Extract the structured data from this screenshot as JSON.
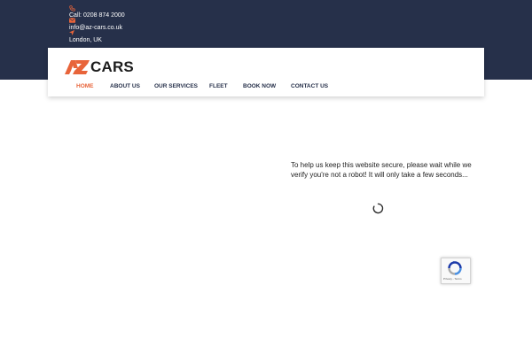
{
  "contact": {
    "phone": "Call: 0208 874 2000",
    "email": "info@az-cars.co.uk",
    "location": "London, UK",
    "phone_icon": "phone-icon",
    "email_icon": "envelope-icon",
    "location_icon": "location-arrow-icon"
  },
  "logo": {
    "text": "CARS",
    "mark": "AZ"
  },
  "nav": {
    "items": [
      {
        "label": "HOME",
        "active": true
      },
      {
        "label": "ABOUT US",
        "active": false
      },
      {
        "label": "OUR SERVICES",
        "active": false
      },
      {
        "label": "FLEET",
        "active": false
      },
      {
        "label": "BOOK NOW",
        "active": false
      },
      {
        "label": "CONTACT US",
        "active": false
      }
    ]
  },
  "security": {
    "message": "To help us keep this website secure, please wait while we verify you're not a robot! It will only take a few seconds..."
  },
  "recaptcha": {
    "footer": "Privacy - Terms"
  },
  "colors": {
    "header_bg": "#26304a",
    "accent": "#e8643a",
    "nav_text": "#26304a"
  }
}
